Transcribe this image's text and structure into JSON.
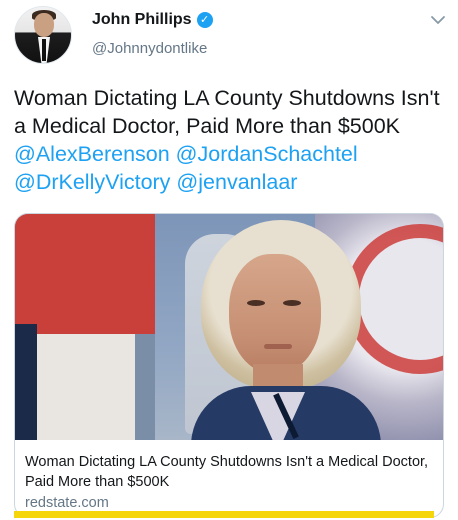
{
  "user": {
    "display_name": "John Phillips",
    "handle": "@Johnnydontlike",
    "verified": true,
    "avatar_icon": "profile-photo"
  },
  "tweet": {
    "text_plain": "Woman Dictating LA County Shutdowns Isn't a Medical Doctor, Paid More than $500K",
    "mentions": [
      "@AlexBerenson",
      "@JordanSchachtel",
      "@DrKellyVictory",
      "@jenvanlaar"
    ]
  },
  "card": {
    "title": "Woman Dictating LA County Shutdowns Isn't a Medical Doctor, Paid More than $500K",
    "domain": "redstate.com",
    "image_icon": "article-photo"
  },
  "colors": {
    "link_blue": "#1da1f2",
    "text_dark": "#14171a",
    "muted_gray": "#657786",
    "verified_blue": "#1da1f2",
    "highlight_yellow": "#f5d60a"
  },
  "icons": {
    "verified": "verified-badge-icon",
    "menu": "chevron-down-icon"
  }
}
